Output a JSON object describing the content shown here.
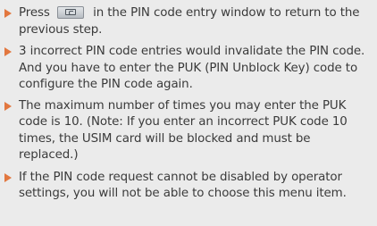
{
  "notes": [
    {
      "before": "Press",
      "key_icon": "clear-key-icon",
      "after": "in the PIN code entry window to return to the previous step."
    },
    {
      "text": "3 incorrect PIN code entries would invalidate the PIN code. And you have to enter the PUK (PIN Unblock Key) code to configure the PIN code again."
    },
    {
      "text": "The maximum number of times you may enter the PUK code is 10. (Note: If you enter an incorrect PUK code 10 times, the USIM card will be blocked and must be replaced.)"
    },
    {
      "text": "If the PIN code request cannot be disabled by operator settings, you will not be able to choose this menu item."
    }
  ],
  "colors": {
    "bullet": "#e2773f",
    "background": "#ebebeb",
    "text": "#3a3a3a"
  }
}
